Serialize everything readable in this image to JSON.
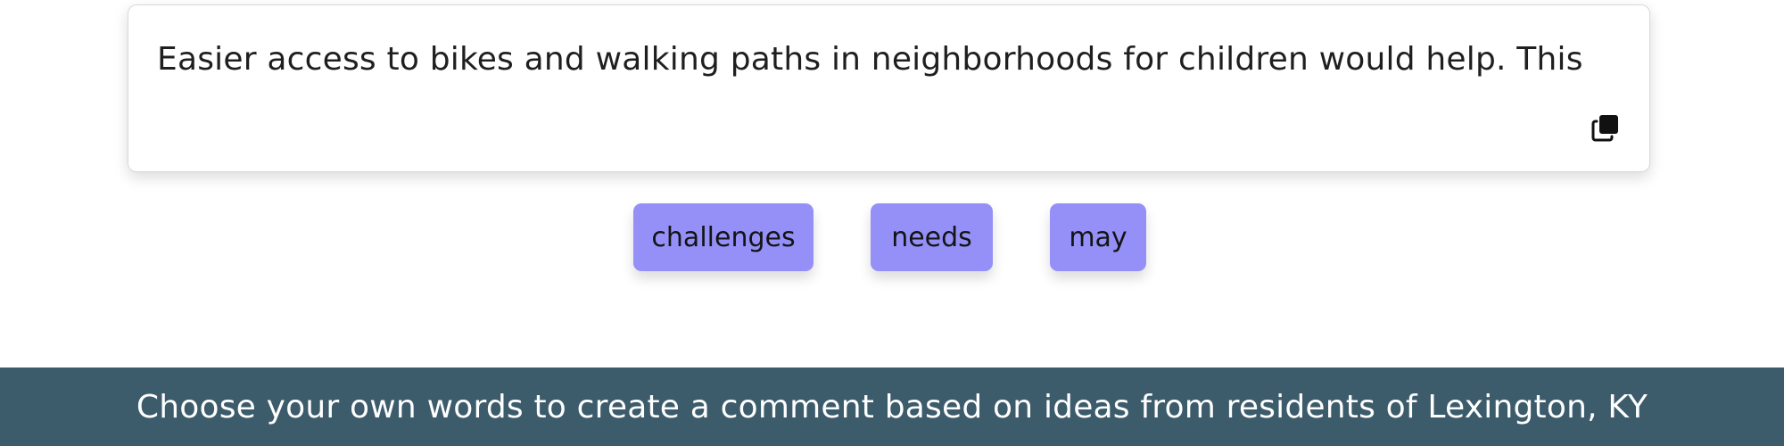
{
  "comment": {
    "text": "Easier access to bikes and walking paths in neighborhoods for children would help. This",
    "copy_icon": "copy-icon"
  },
  "word_choices": [
    {
      "label": "challenges"
    },
    {
      "label": "needs"
    },
    {
      "label": "may"
    }
  ],
  "footer": {
    "text": "Choose your own words to create a comment based on ideas from residents of Lexington, KY"
  },
  "colors": {
    "chip_background": "#9590f8",
    "footer_background": "#3c5b6b",
    "text": "#1f1f1f"
  }
}
